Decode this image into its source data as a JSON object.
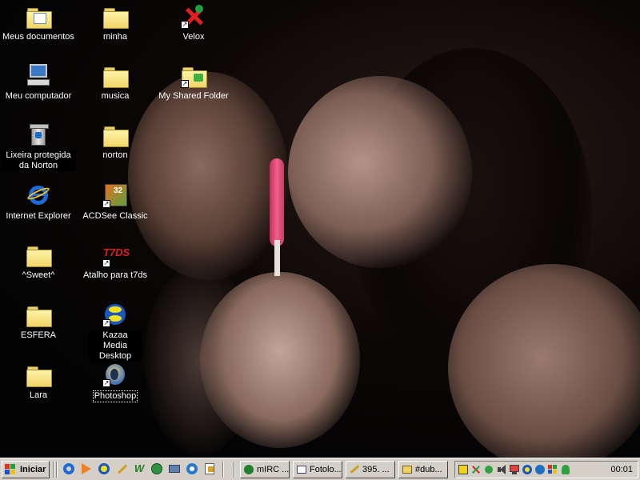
{
  "desktop": {
    "icons": [
      {
        "id": "meus-documentos",
        "label": "Meus documentos",
        "icon": "my-documents-icon"
      },
      {
        "id": "meu-computador",
        "label": "Meu computador",
        "icon": "my-computer-icon"
      },
      {
        "id": "lixeira",
        "label": "Lixeira protegida da Norton",
        "icon": "recycle-bin-icon"
      },
      {
        "id": "internet-explorer",
        "label": "Internet Explorer",
        "icon": "internet-explorer-icon"
      },
      {
        "id": "sweet",
        "label": "^Sweet^",
        "icon": "folder-icon"
      },
      {
        "id": "esfera",
        "label": "ESFERA",
        "icon": "folder-icon"
      },
      {
        "id": "lara",
        "label": "Lara",
        "icon": "folder-icon"
      },
      {
        "id": "minha",
        "label": "minha",
        "icon": "folder-icon"
      },
      {
        "id": "musica",
        "label": "musica",
        "icon": "folder-icon"
      },
      {
        "id": "norton",
        "label": "norton",
        "icon": "folder-icon"
      },
      {
        "id": "acdsee",
        "label": "ACDSee Classic",
        "icon": "acdsee-icon"
      },
      {
        "id": "t7ds",
        "label": "Atalho para t7ds",
        "icon": "t7ds-icon"
      },
      {
        "id": "kazaa",
        "label": "Kazaa Media Desktop",
        "icon": "kazaa-icon"
      },
      {
        "id": "photoshop",
        "label": "Photoshop",
        "icon": "photoshop-icon"
      },
      {
        "id": "velox",
        "label": "Velox",
        "icon": "velox-icon"
      },
      {
        "id": "shared-folder",
        "label": "My Shared Folder",
        "icon": "shared-folder-icon"
      }
    ]
  },
  "taskbar": {
    "start_label": "Iniciar",
    "quick_launch": [
      "internet-explorer-icon",
      "media-player-icon",
      "kazaa-icon",
      "pen-icon",
      "word-icon",
      "network-icon",
      "gear-icon",
      "outlook-icon",
      "document-icon"
    ],
    "tasks": [
      {
        "label": "mIRC ...",
        "icon": "mirc-icon"
      },
      {
        "label": "Fotolo...",
        "icon": "explorer-window-icon"
      },
      {
        "label": "395. ...",
        "icon": "kazaa-download-icon"
      },
      {
        "label": "#dub...",
        "icon": "chat-icon"
      }
    ],
    "tray_icons": [
      "norton-icon",
      "velox-tray-icon",
      "network-tray-icon",
      "volume-icon",
      "monitor-icon",
      "kazaa-tray-icon",
      "globe-icon",
      "windows-icon",
      "messenger-icon"
    ],
    "clock": "00:01"
  },
  "colors": {
    "taskbar_bg": "#d4d0c8",
    "desktop_bg": "#050505",
    "label_text": "#ffffff"
  }
}
